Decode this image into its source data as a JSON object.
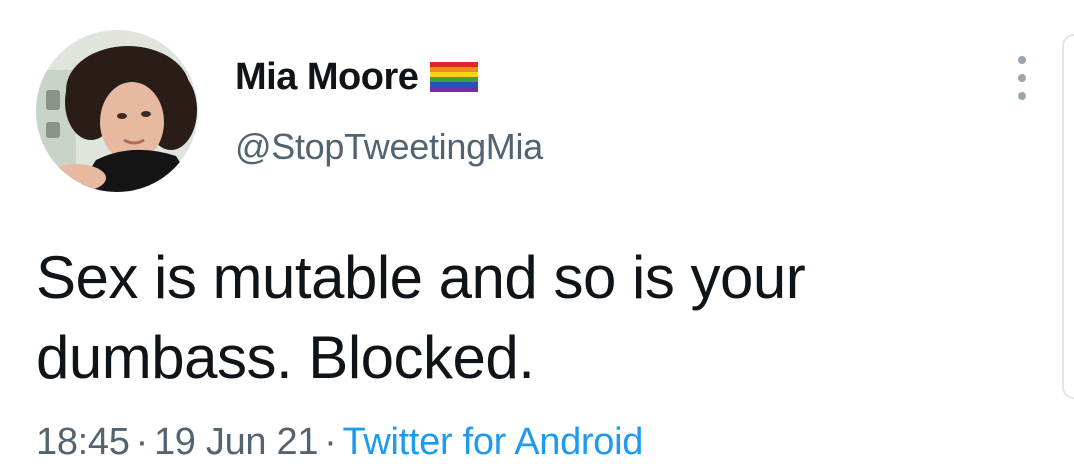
{
  "tweet": {
    "author": {
      "display_name": "Mia Moore",
      "handle": "@StopTweetingMia",
      "name_emoji_icon": "rainbow-flag-icon",
      "avatar_icon": "profile-photo"
    },
    "text_line1": "Sex is mutable and so is your",
    "text_line2": "dumbass. Blocked.",
    "time": "18:45",
    "date": "19 Jun 21",
    "separator": "·",
    "source": "Twitter for Android",
    "more_icon": "more-vertical-icon"
  },
  "colors": {
    "text_primary": "#0f1419",
    "text_secondary": "#536471",
    "link": "#1d9bf0"
  }
}
